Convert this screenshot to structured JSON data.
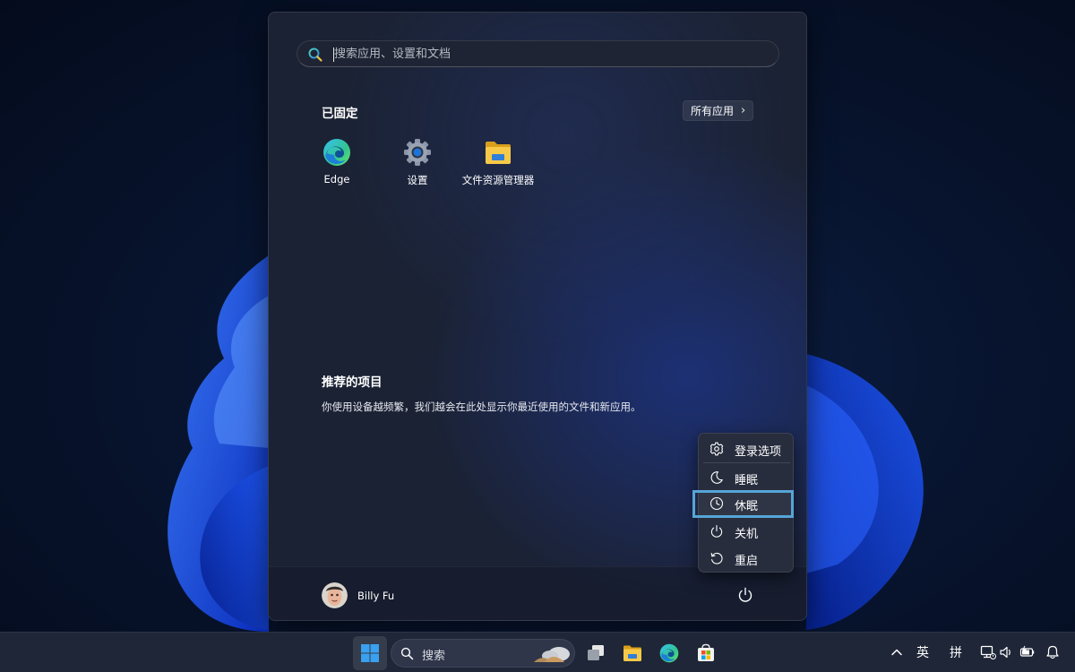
{
  "start_menu": {
    "search": {
      "placeholder": "搜索应用、设置和文档"
    },
    "pinned": {
      "title": "已固定",
      "all_apps_label": "所有应用",
      "apps": [
        {
          "label": "Edge",
          "icon": "edge-icon"
        },
        {
          "label": "设置",
          "icon": "gear-icon"
        },
        {
          "label": "文件资源管理器",
          "icon": "folder-icon"
        }
      ]
    },
    "recommended": {
      "title": "推荐的项目",
      "description": "你使用设备越频繁，我们越会在此处显示你最近使用的文件和新应用。"
    },
    "user": {
      "name": "Billy Fu"
    }
  },
  "power_menu": {
    "items": [
      {
        "label": "登录选项",
        "icon": "gear-icon"
      },
      {
        "label": "睡眠",
        "icon": "moon-icon"
      },
      {
        "label": "休眠",
        "icon": "clock-icon",
        "focused": true
      },
      {
        "label": "关机",
        "icon": "power-icon"
      },
      {
        "label": "重启",
        "icon": "restart-icon"
      }
    ]
  },
  "taskbar": {
    "search_label": "搜索",
    "tray": {
      "language": "英",
      "ime": "拼"
    }
  },
  "colors": {
    "focus_outline": "#56a5d6",
    "taskbar": "#1f2637",
    "menu_background": "#1b2234"
  }
}
